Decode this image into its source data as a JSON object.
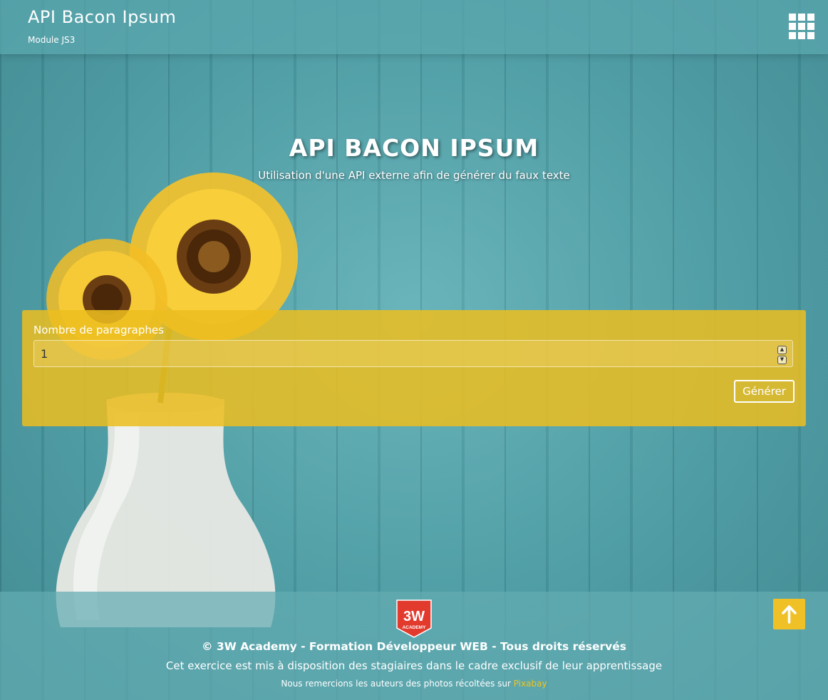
{
  "header": {
    "title": "API Bacon Ipsum",
    "subtitle": "Module JS3",
    "menu_icon": "apps-grid-icon"
  },
  "hero": {
    "title": "API BACON IPSUM",
    "subtitle": "Utilisation d'une API externe afin de générer du faux texte"
  },
  "form": {
    "label": "Nombre de paragraphes",
    "value": "1",
    "generate_label": "Générer",
    "spinner_up_icon": "chevron-up-icon",
    "spinner_down_icon": "chevron-down-icon"
  },
  "footer": {
    "logo_text_main": "3W",
    "logo_text_sub": "ACADEMY",
    "copyright": "© 3W Academy - Formation Développeur WEB - Tous droits réservés",
    "notice": "Cet exercice est mis à disposition des stagiaires dans le cadre exclusif de leur apprentissage",
    "credits_prefix": "Nous remercions les auteurs des photos récoltées sur ",
    "credits_link": "Pixabay",
    "scroll_top_icon": "arrow-up-icon"
  },
  "colors": {
    "accent": "#f0c127",
    "panel": "#ecbe20",
    "background": "#4f9ea5",
    "logo_red": "#e33a2e"
  }
}
